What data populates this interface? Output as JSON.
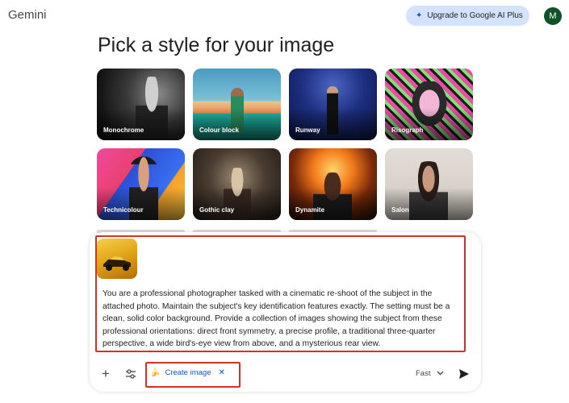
{
  "app": {
    "title": "Gemini"
  },
  "header": {
    "upgrade_label": "Upgrade to Google AI Plus",
    "avatar_letter": "M"
  },
  "page": {
    "title": "Pick a style for your image"
  },
  "styles": [
    {
      "label": "Monochrome"
    },
    {
      "label": "Colour block"
    },
    {
      "label": "Runway"
    },
    {
      "label": "Risograph"
    },
    {
      "label": "Technicolour"
    },
    {
      "label": "Gothic clay"
    },
    {
      "label": "Dynamite"
    },
    {
      "label": "Salon"
    }
  ],
  "composer": {
    "prompt": "You are a professional photographer tasked with a cinematic re-shoot of the subject in the attached photo. Maintain the subject's key identification features exactly. The setting must be a clean, solid color background. Provide a collection of images showing the subject from these professional orientations: direct front symmetry, a precise profile, a traditional three-quarter perspective, a wide bird's-eye view from above, and a mysterious rear view.",
    "tool_chip": {
      "icon": "🍌",
      "label": "Create image",
      "close": "✕"
    },
    "model": "Fast",
    "add_icon": "+"
  },
  "icons": {
    "upgrade": "sparkle-icon",
    "add": "plus-icon",
    "tools": "tune-icon",
    "send": "send-icon",
    "chevron": "chevron-down-icon"
  },
  "colors": {
    "accent": "#0b57d0",
    "upgrade_bg": "#d3e3fd",
    "avatar_bg": "#0f5223",
    "highlight": "#d93025"
  }
}
